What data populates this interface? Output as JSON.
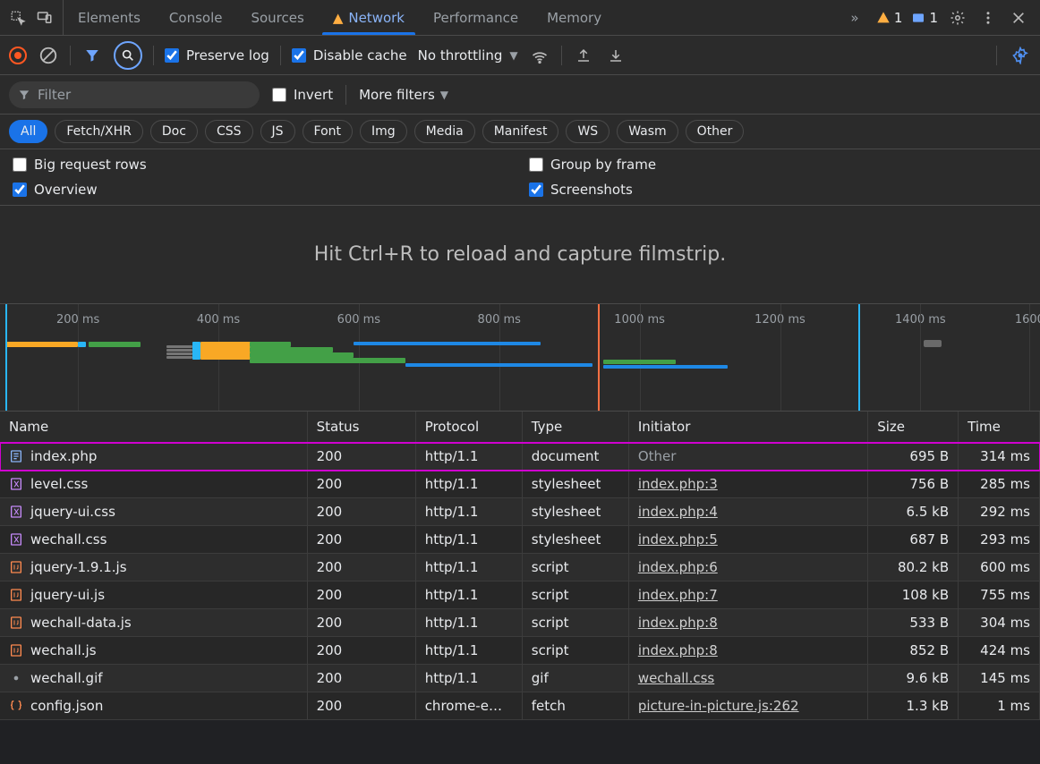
{
  "tabs": {
    "list": [
      "Elements",
      "Console",
      "Sources",
      "Network",
      "Performance",
      "Memory"
    ],
    "active_index": 3,
    "network_warn_icon": true,
    "more_icon": "»",
    "issues": {
      "warn_count": "1",
      "info_count": "1"
    }
  },
  "toolbar": {
    "preserve_log": "Preserve log",
    "disable_cache": "Disable cache",
    "throttling": "No throttling"
  },
  "filter": {
    "placeholder": "Filter",
    "invert": "Invert",
    "more_filters": "More filters",
    "pills": [
      "All",
      "Fetch/XHR",
      "Doc",
      "CSS",
      "JS",
      "Font",
      "Img",
      "Media",
      "Manifest",
      "WS",
      "Wasm",
      "Other"
    ],
    "active_pill": 0
  },
  "options": {
    "big_rows": "Big request rows",
    "group_by_frame": "Group by frame",
    "overview": "Overview",
    "screenshots": "Screenshots"
  },
  "filmstrip": {
    "hint": "Hit Ctrl+R to reload and capture filmstrip."
  },
  "timeline": {
    "labels": [
      "200 ms",
      "400 ms",
      "600 ms",
      "800 ms",
      "1000 ms",
      "1200 ms",
      "1400 ms",
      "1600"
    ]
  },
  "columns": {
    "name": "Name",
    "status": "Status",
    "protocol": "Protocol",
    "type": "Type",
    "initiator": "Initiator",
    "size": "Size",
    "time": "Time"
  },
  "requests": [
    {
      "icon": "doc",
      "icon_color": "#8ab4f8",
      "name": "index.php",
      "status": "200",
      "protocol": "http/1.1",
      "type": "document",
      "initiator": "Other",
      "initiator_link": false,
      "size": "695 B",
      "time": "314 ms",
      "highlight": true
    },
    {
      "icon": "css",
      "icon_color": "#c58af9",
      "name": "level.css",
      "status": "200",
      "protocol": "http/1.1",
      "type": "stylesheet",
      "initiator": "index.php:3",
      "initiator_link": true,
      "size": "756 B",
      "time": "285 ms"
    },
    {
      "icon": "css",
      "icon_color": "#c58af9",
      "name": "jquery-ui.css",
      "status": "200",
      "protocol": "http/1.1",
      "type": "stylesheet",
      "initiator": "index.php:4",
      "initiator_link": true,
      "size": "6.5 kB",
      "time": "292 ms"
    },
    {
      "icon": "css",
      "icon_color": "#c58af9",
      "name": "wechall.css",
      "status": "200",
      "protocol": "http/1.1",
      "type": "stylesheet",
      "initiator": "index.php:5",
      "initiator_link": true,
      "size": "687 B",
      "time": "293 ms"
    },
    {
      "icon": "js",
      "icon_color": "#ff8a50",
      "name": "jquery-1.9.1.js",
      "status": "200",
      "protocol": "http/1.1",
      "type": "script",
      "initiator": "index.php:6",
      "initiator_link": true,
      "size": "80.2 kB",
      "time": "600 ms"
    },
    {
      "icon": "js",
      "icon_color": "#ff8a50",
      "name": "jquery-ui.js",
      "status": "200",
      "protocol": "http/1.1",
      "type": "script",
      "initiator": "index.php:7",
      "initiator_link": true,
      "size": "108 kB",
      "time": "755 ms"
    },
    {
      "icon": "js",
      "icon_color": "#ff8a50",
      "name": "wechall-data.js",
      "status": "200",
      "protocol": "http/1.1",
      "type": "script",
      "initiator": "index.php:8",
      "initiator_link": true,
      "size": "533 B",
      "time": "304 ms"
    },
    {
      "icon": "js",
      "icon_color": "#ff8a50",
      "name": "wechall.js",
      "status": "200",
      "protocol": "http/1.1",
      "type": "script",
      "initiator": "index.php:8",
      "initiator_link": true,
      "size": "852 B",
      "time": "424 ms"
    },
    {
      "icon": "img",
      "icon_color": "#9aa0a6",
      "name": "wechall.gif",
      "status": "200",
      "protocol": "http/1.1",
      "type": "gif",
      "initiator": "wechall.css",
      "initiator_link": true,
      "size": "9.6 kB",
      "time": "145 ms"
    },
    {
      "icon": "json",
      "icon_color": "#ff8a50",
      "name": "config.json",
      "status": "200",
      "protocol": "chrome-e…",
      "type": "fetch",
      "initiator": "picture-in-picture.js:262",
      "initiator_link": true,
      "size": "1.3 kB",
      "time": "1 ms"
    }
  ]
}
